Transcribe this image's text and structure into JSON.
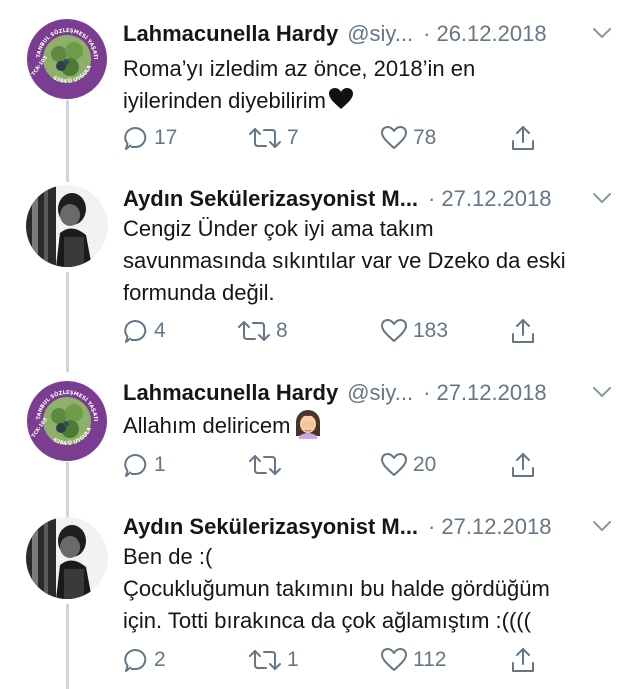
{
  "tweets": [
    {
      "name": "Lahmacunella Hardy",
      "handle": "@siy...",
      "dot": "·",
      "date": "26.12.2018",
      "lines": [
        "Roma’yı izledim az önce, 2018’in en",
        "iyilerinden diyebilirim"
      ],
      "emoji": "black-heart",
      "avatar": "purple-badge",
      "avatar_ring_text_top": "İSTANBUL SÖZLEŞMESİ YAŞATIR",
      "avatar_ring_text_left": "TCK-103",
      "avatar_ring_text_bottom": "6284'Ü UYGULA",
      "replies": "17",
      "retweets": "7",
      "likes": "78"
    },
    {
      "name": "Aydın Sekülerizasyonist M...",
      "handle": "",
      "dot": "·",
      "date": "27.12.2018",
      "lines": [
        "Cengiz Ünder çok iyi ama takım",
        "savunmasında sıkıntılar var ve Dzeko da eski",
        "formunda değil."
      ],
      "emoji": "",
      "avatar": "bw-photo",
      "replies": "4",
      "retweets": "8",
      "likes": "183"
    },
    {
      "name": "Lahmacunella Hardy",
      "handle": "@siy...",
      "dot": "·",
      "date": "27.12.2018",
      "lines": [
        "Allahım deliricem"
      ],
      "emoji": "facepalm-woman",
      "avatar": "purple-badge",
      "avatar_ring_text_top": "İSTANBUL SÖZLEŞMESİ YAŞATIR",
      "avatar_ring_text_left": "TCK-103",
      "avatar_ring_text_bottom": "6284'Ü UYGULA",
      "replies": "1",
      "retweets": "",
      "likes": "20"
    },
    {
      "name": "Aydın Sekülerizasyonist M...",
      "handle": "",
      "dot": "·",
      "date": "27.12.2018",
      "lines": [
        "Ben de :(",
        "Çocukluğumun takımını bu halde gördüğüm",
        "için. Totti bırakınca da çok ağlamıştım :(((("
      ],
      "emoji": "",
      "avatar": "bw-photo",
      "replies": "2",
      "retweets": "1",
      "likes": "112"
    }
  ],
  "icons": {
    "reply": "reply-icon",
    "retweet": "retweet-icon",
    "like": "heart-icon",
    "share": "share-icon",
    "menu": "chevron-down-icon"
  },
  "colors": {
    "text": "#14171a",
    "secondary": "#657786",
    "thread_line": "#ccd6dd",
    "badge_purple": "#7b3d91"
  }
}
